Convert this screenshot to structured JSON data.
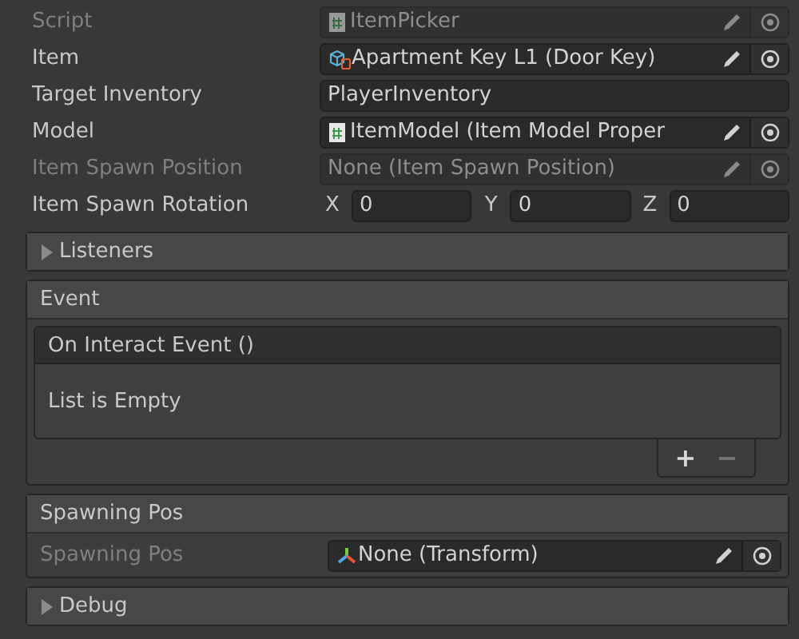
{
  "properties": [
    {
      "label": "Script",
      "kind": "script",
      "value": "ItemPicker",
      "disabled": true
    },
    {
      "label": "Item",
      "kind": "asset",
      "value": "Apartment Key L1 (Door Key)",
      "disabled": false
    },
    {
      "label": "Target Inventory",
      "kind": "text",
      "value": "PlayerInventory",
      "disabled": false
    },
    {
      "label": "Model",
      "kind": "script",
      "value": "ItemModel (Item Model Proper",
      "disabled": false
    },
    {
      "label": "Item Spawn Position",
      "kind": "none",
      "value": "None (Item Spawn Position)",
      "disabled": true
    },
    {
      "label": "Item Spawn Rotation",
      "kind": "vector3",
      "axes": [
        {
          "axis": "X",
          "value": "0"
        },
        {
          "axis": "Y",
          "value": "0"
        },
        {
          "axis": "Z",
          "value": "0"
        }
      ]
    }
  ],
  "listeners": {
    "title": "Listeners",
    "expanded": false
  },
  "event": {
    "title": "Event",
    "list_title": "On Interact Event ()",
    "empty_text": "List is Empty",
    "add": "+",
    "remove": "−"
  },
  "spawning": {
    "title": "Spawning Pos",
    "field": {
      "label": "Spawning Pos",
      "kind": "transform",
      "value": "None (Transform)",
      "disabled": false,
      "label_greyed": true
    }
  },
  "debug": {
    "title": "Debug",
    "expanded": false
  }
}
